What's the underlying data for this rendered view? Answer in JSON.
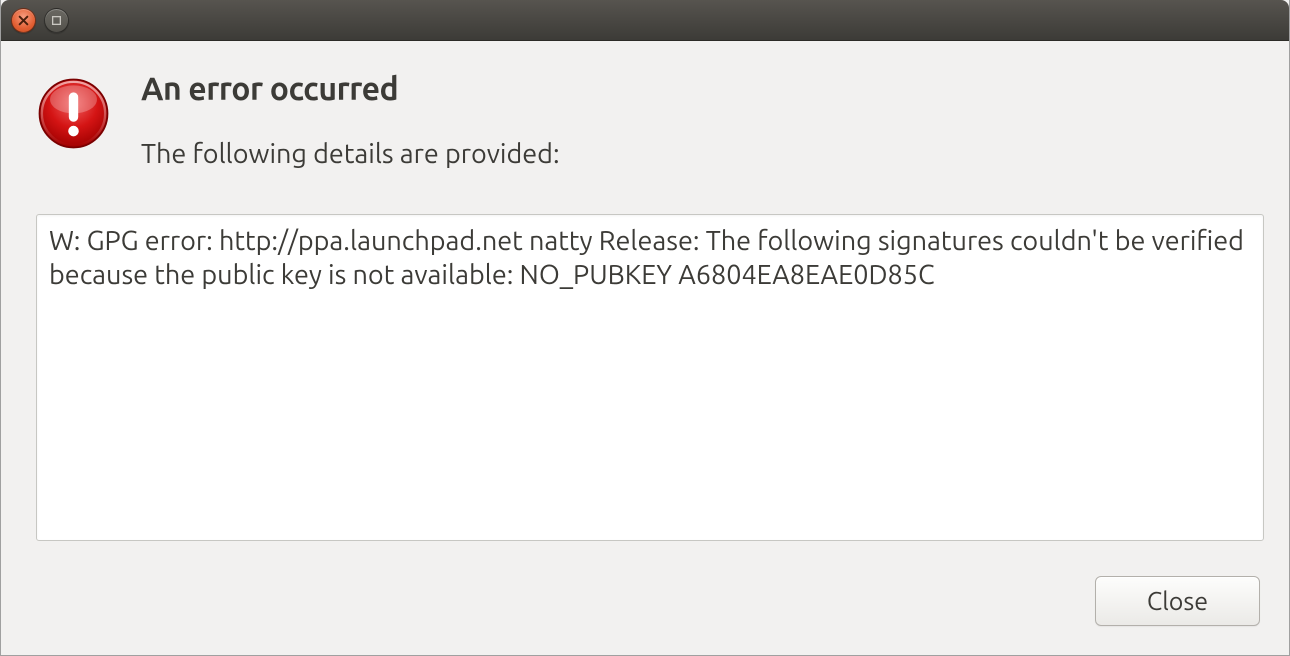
{
  "titlebar": {
    "close_tooltip": "Close",
    "minimize_tooltip": "Minimize"
  },
  "dialog": {
    "title": "An error occurred",
    "subtitle": "The following details are provided:",
    "details": "W: GPG error: http://ppa.launchpad.net natty Release: The following signatures couldn't be verified because the public key is not available: NO_PUBKEY A6804EA8EAE0D85C"
  },
  "buttons": {
    "close_label": "Close"
  },
  "colors": {
    "window_bg": "#f2f1f0",
    "text": "#3c3b37",
    "error_red": "#c40000"
  }
}
